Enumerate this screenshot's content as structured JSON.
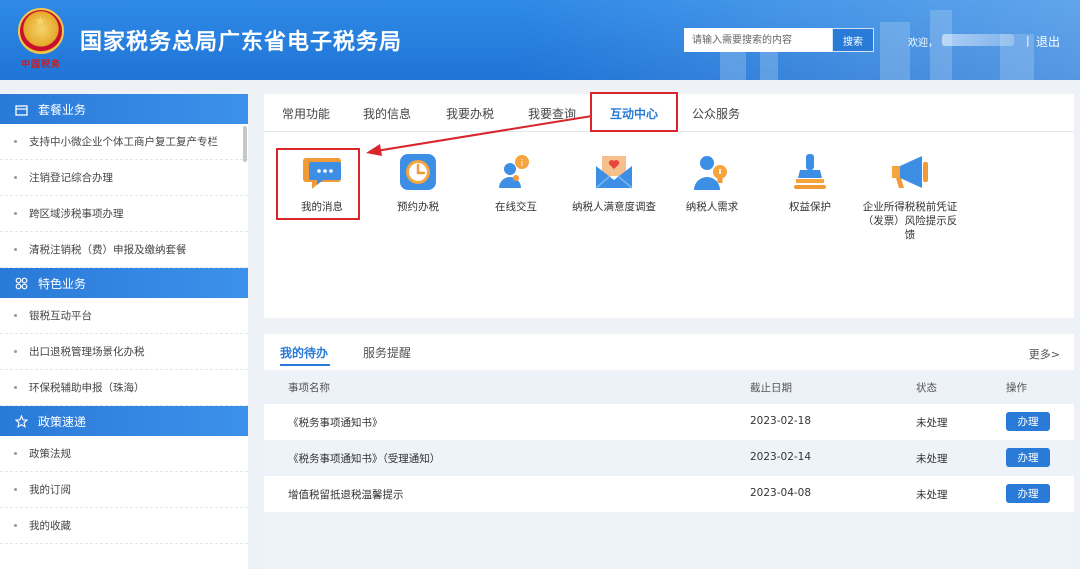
{
  "header": {
    "title": "国家税务总局广东省电子税务局",
    "seal_text": "中国税务",
    "search_placeholder": "请输入需要搜索的内容",
    "search_button": "搜索",
    "welcome": "欢迎，",
    "separator": "|",
    "logout": "退出"
  },
  "sidebar": {
    "sections": [
      {
        "title": "套餐业务",
        "icon": "box-icon",
        "items": [
          "支持中小微企业个体工商户复工复产专栏",
          "注销登记综合办理",
          "跨区域涉税事项办理",
          "清税注销税（费）申报及缴纳套餐"
        ]
      },
      {
        "title": "特色业务",
        "icon": "grid-icon",
        "items": [
          "银税互动平台",
          "出口退税管理场景化办税",
          "环保税辅助申报（珠海）"
        ]
      },
      {
        "title": "政策速递",
        "icon": "star-icon",
        "items": [
          "政策法规",
          "我的订阅",
          "我的收藏"
        ]
      }
    ]
  },
  "tabs": [
    "常用功能",
    "我的信息",
    "我要办税",
    "我要查询",
    "互动中心",
    "公众服务"
  ],
  "active_tab": "互动中心",
  "features": [
    {
      "label": "我的消息",
      "icon": "message-bubble-icon"
    },
    {
      "label": "预约办税",
      "icon": "clock-icon"
    },
    {
      "label": "在线交互",
      "icon": "online-interaction-icon"
    },
    {
      "label": "纳税人满意度调查",
      "icon": "envelope-heart-icon"
    },
    {
      "label": "纳税人需求",
      "icon": "person-lightbulb-icon"
    },
    {
      "label": "权益保护",
      "icon": "seal-stamp-icon"
    },
    {
      "label": "企业所得税税前凭证（发票）风险提示反馈",
      "icon": "megaphone-icon"
    }
  ],
  "todo": {
    "tabs": [
      "我的待办",
      "服务提醒"
    ],
    "more": "更多>",
    "columns": [
      "事项名称",
      "截止日期",
      "状态",
      "操作"
    ],
    "rows": [
      {
        "name": "《税务事项通知书》",
        "date": "2023-02-18",
        "status": "未处理",
        "action": "办理"
      },
      {
        "name": "《税务事项通知书》（受理通知）",
        "date": "2023-02-14",
        "status": "未处理",
        "action": "办理"
      },
      {
        "name": "增值税留抵退税温馨提示",
        "date": "2023-04-08",
        "status": "未处理",
        "action": "办理"
      }
    ]
  },
  "colors": {
    "primary": "#2a7ad8",
    "highlight": "#d9262c",
    "header_bg": "#2480e0"
  }
}
